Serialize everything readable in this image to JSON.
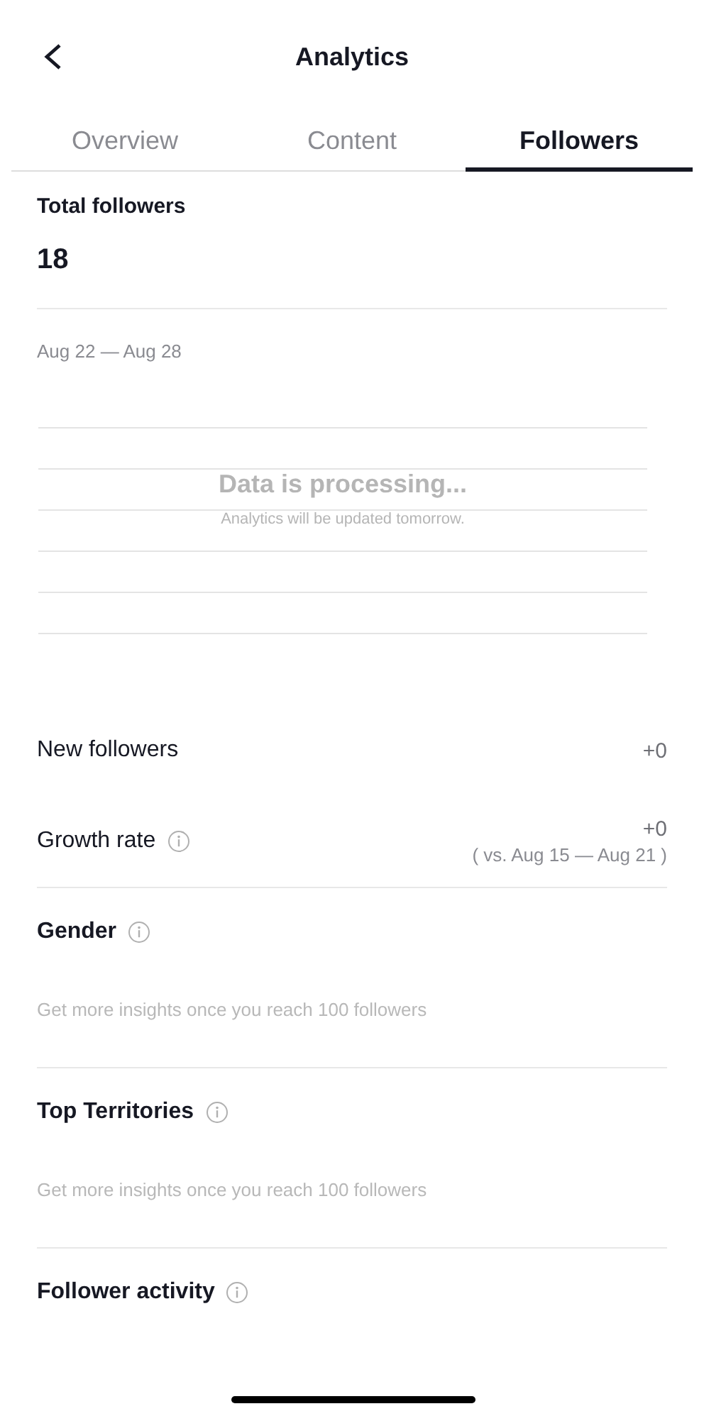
{
  "header": {
    "title": "Analytics"
  },
  "tabs": [
    {
      "label": "Overview",
      "selected": false
    },
    {
      "label": "Content",
      "selected": false
    },
    {
      "label": "Followers",
      "selected": true
    }
  ],
  "total": {
    "label": "Total followers",
    "value": "18"
  },
  "range": "Aug 22 — Aug 28",
  "chart_placeholder": {
    "title": "Data is processing...",
    "subtitle": "Analytics will be updated tomorrow."
  },
  "stats": [
    {
      "label": "New followers",
      "value": "+0",
      "info": false
    },
    {
      "label": "Growth rate",
      "value": "+0",
      "info": true,
      "note": "( vs. Aug 15 — Aug 21 )"
    }
  ],
  "sections": [
    {
      "title": "Gender",
      "hint": "Get more insights once you reach 100 followers"
    },
    {
      "title": "Top Territories",
      "hint": "Get more insights once you reach 100 followers"
    },
    {
      "title": "Follower activity"
    }
  ]
}
